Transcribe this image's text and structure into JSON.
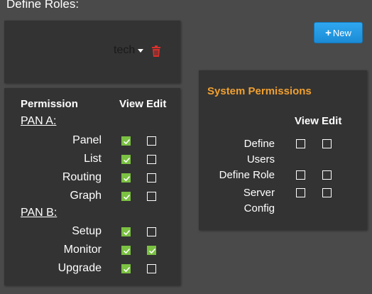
{
  "page": {
    "title": "Define Roles:"
  },
  "role": {
    "selected": "tech",
    "delete_icon": "trash-icon"
  },
  "new_button": {
    "label": "New",
    "icon": "plus-icon"
  },
  "permissions": {
    "header": {
      "permission": "Permission",
      "view": "View",
      "edit": "Edit"
    },
    "sections": [
      {
        "name": "PAN A:",
        "rows": [
          {
            "label": "Panel",
            "view": true,
            "edit": false
          },
          {
            "label": "List",
            "view": true,
            "edit": false
          },
          {
            "label": "Routing",
            "view": true,
            "edit": false
          },
          {
            "label": "Graph",
            "view": true,
            "edit": false
          }
        ]
      },
      {
        "name": "PAN B:",
        "rows": [
          {
            "label": "Setup",
            "view": true,
            "edit": false
          },
          {
            "label": "Monitor",
            "view": true,
            "edit": true
          },
          {
            "label": "Upgrade",
            "view": true,
            "edit": false
          }
        ]
      }
    ]
  },
  "system_permissions": {
    "title": "System Permissions",
    "header": {
      "view": "View",
      "edit": "Edit"
    },
    "rows": [
      {
        "label_line1": "Define",
        "label_line2": "Users",
        "view": false,
        "edit": false
      },
      {
        "label_line1": "Define Role",
        "view": false,
        "edit": false
      },
      {
        "label_line1": "Server",
        "label_line2": "Config",
        "view": false,
        "edit": false
      }
    ]
  },
  "colors": {
    "background": "#4a4a4a",
    "panel": "#333333",
    "checked": "#7bc142",
    "accent_button": "#1b8bd6",
    "section_title": "#f0a030",
    "delete": "#d9302c"
  }
}
